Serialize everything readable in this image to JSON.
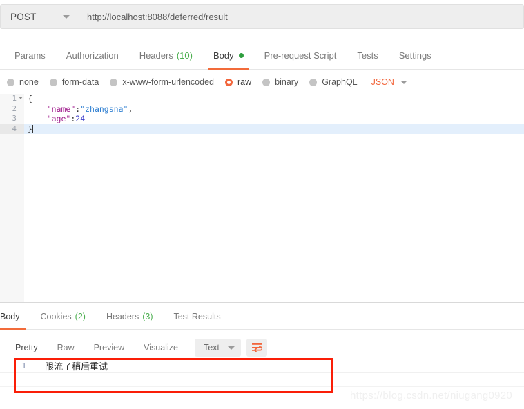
{
  "request": {
    "method": "POST",
    "url": "http://localhost:8088/deferred/result",
    "tabs": [
      {
        "label": "Params",
        "active": false
      },
      {
        "label": "Authorization",
        "active": false
      },
      {
        "label": "Headers",
        "count": "(10)",
        "active": false
      },
      {
        "label": "Body",
        "active": true,
        "dot": true
      },
      {
        "label": "Pre-request Script",
        "active": false
      },
      {
        "label": "Tests",
        "active": false
      },
      {
        "label": "Settings",
        "active": false
      }
    ],
    "body_types": [
      {
        "label": "none",
        "selected": false
      },
      {
        "label": "form-data",
        "selected": false
      },
      {
        "label": "x-www-form-urlencoded",
        "selected": false
      },
      {
        "label": "raw",
        "selected": true
      },
      {
        "label": "binary",
        "selected": false
      },
      {
        "label": "GraphQL",
        "selected": false
      }
    ],
    "format_label": "JSON",
    "editor": {
      "lines": [
        {
          "num": "1",
          "code": "{"
        },
        {
          "num": "2",
          "code": "    \"name\":\"zhangsna\","
        },
        {
          "num": "3",
          "code": "    \"age\":24"
        },
        {
          "num": "4",
          "code": "}"
        }
      ],
      "line1_open_brace": "{",
      "line2_key": "\"name\"",
      "line2_colon": ":",
      "line2_val": "\"zhangsna\"",
      "line2_comma": ",",
      "line3_key": "\"age\"",
      "line3_colon": ":",
      "line3_val": "24",
      "line4_close_brace": "}"
    }
  },
  "response": {
    "tabs": [
      {
        "label": "Body",
        "active": true
      },
      {
        "label": "Cookies",
        "count": "(2)",
        "active": false
      },
      {
        "label": "Headers",
        "count": "(3)",
        "active": false
      },
      {
        "label": "Test Results",
        "active": false
      }
    ],
    "format_tabs": [
      {
        "label": "Pretty",
        "active": true
      },
      {
        "label": "Raw",
        "active": false
      },
      {
        "label": "Preview",
        "active": false
      },
      {
        "label": "Visualize",
        "active": false
      }
    ],
    "content_type": "Text",
    "body_lines": [
      {
        "num": "1",
        "text": "限流了稍后重试"
      }
    ]
  },
  "watermark": "https://blog.csdn.net/niugang0920",
  "colors": {
    "accent": "#f26b3a",
    "annotation": "#fa1e08",
    "success": "#2e9e3e",
    "count": "#4caf50"
  }
}
